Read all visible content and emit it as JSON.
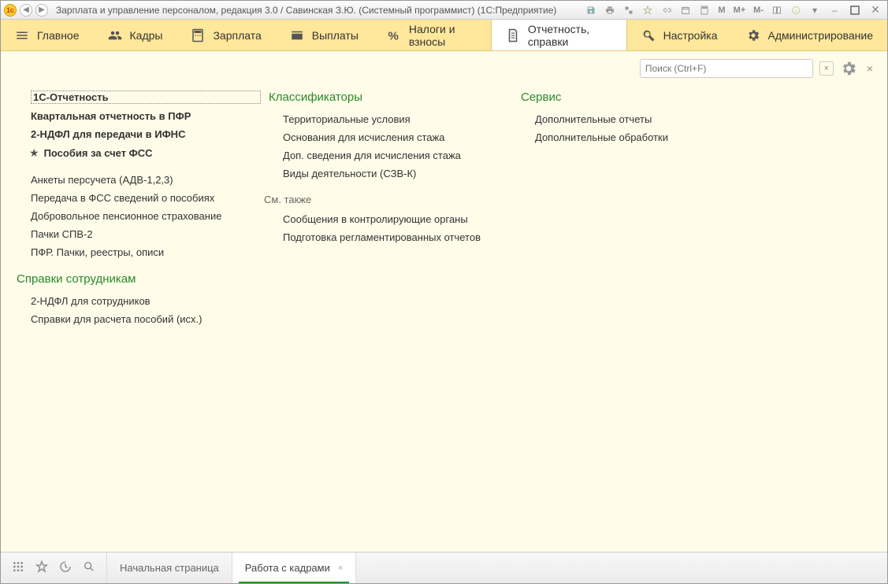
{
  "titlebar": {
    "app_icon_text": "1c",
    "title": "Зарплата и управление персоналом, редакция 3.0 / Савинская З.Ю. (Системный программист)  (1С:Предприятие)",
    "calc_m": "M",
    "calc_mplus": "M+",
    "calc_mminus": "M-"
  },
  "nav": {
    "items": [
      {
        "label": "Главное"
      },
      {
        "label": "Кадры"
      },
      {
        "label": "Зарплата"
      },
      {
        "label": "Выплаты"
      },
      {
        "label": "Налоги и взносы"
      },
      {
        "label": "Отчетность, справки"
      },
      {
        "label": "Настройка"
      },
      {
        "label": "Администрирование"
      }
    ]
  },
  "search": {
    "placeholder": "Поиск (Ctrl+F)",
    "clear": "×"
  },
  "content_close": "×",
  "col1": {
    "top": [
      {
        "label": "1С-Отчетность",
        "style": "dashed"
      },
      {
        "label": "Квартальная отчетность в ПФР",
        "style": "bold"
      },
      {
        "label": "2-НДФЛ для передачи в ИФНС",
        "style": "bold"
      },
      {
        "label": "Пособия за счет ФСС",
        "style": "star"
      }
    ],
    "mid": [
      {
        "label": "Анкеты персучета (АДВ-1,2,3)"
      },
      {
        "label": "Передача в ФСС сведений о пособиях"
      },
      {
        "label": "Добровольное пенсионное страхование"
      },
      {
        "label": "Пачки СПВ-2"
      },
      {
        "label": "ПФР. Пачки, реестры, описи"
      }
    ],
    "section2_title": "Справки сотрудникам",
    "section2_items": [
      {
        "label": "2-НДФЛ для сотрудников"
      },
      {
        "label": "Справки для расчета пособий (исх.)"
      }
    ]
  },
  "col2": {
    "title": "Классификаторы",
    "items": [
      {
        "label": "Территориальные условия"
      },
      {
        "label": "Основания для исчисления стажа"
      },
      {
        "label": "Доп. сведения для исчисления стажа"
      },
      {
        "label": "Виды деятельности (СЗВ-К)"
      }
    ],
    "seealso_title": "См. также",
    "seealso_items": [
      {
        "label": "Сообщения в контролирующие органы"
      },
      {
        "label": "Подготовка регламентированных отчетов"
      }
    ]
  },
  "col3": {
    "title": "Сервис",
    "items": [
      {
        "label": "Дополнительные отчеты"
      },
      {
        "label": "Дополнительные обработки"
      }
    ]
  },
  "bottom": {
    "tabs": [
      {
        "label": "Начальная страница",
        "active": false
      },
      {
        "label": "Работа с кадрами",
        "active": true
      }
    ],
    "tab_close": "×"
  }
}
